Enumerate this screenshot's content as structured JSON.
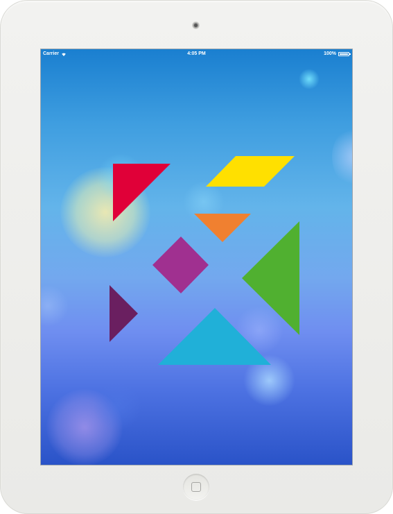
{
  "status_bar": {
    "carrier": "Carrier",
    "wifi_icon": "wifi-icon",
    "time": "4:05 PM",
    "battery_level": "100%",
    "battery_icon": "battery-icon"
  },
  "tangram": {
    "pieces": [
      {
        "name": "tangram-red-triangle",
        "color": "#e00038"
      },
      {
        "name": "tangram-yellow-parallelogram",
        "color": "#ffe000"
      },
      {
        "name": "tangram-orange-triangle",
        "color": "#f08030"
      },
      {
        "name": "tangram-purple-square",
        "color": "#a03090"
      },
      {
        "name": "tangram-green-triangle",
        "color": "#50b030"
      },
      {
        "name": "tangram-dark-purple-triangle",
        "color": "#6a1f60"
      },
      {
        "name": "tangram-cyan-triangle",
        "color": "#20b0d8"
      }
    ]
  },
  "device": {
    "camera_icon": "camera-icon",
    "home_button_icon": "home-button-icon"
  }
}
